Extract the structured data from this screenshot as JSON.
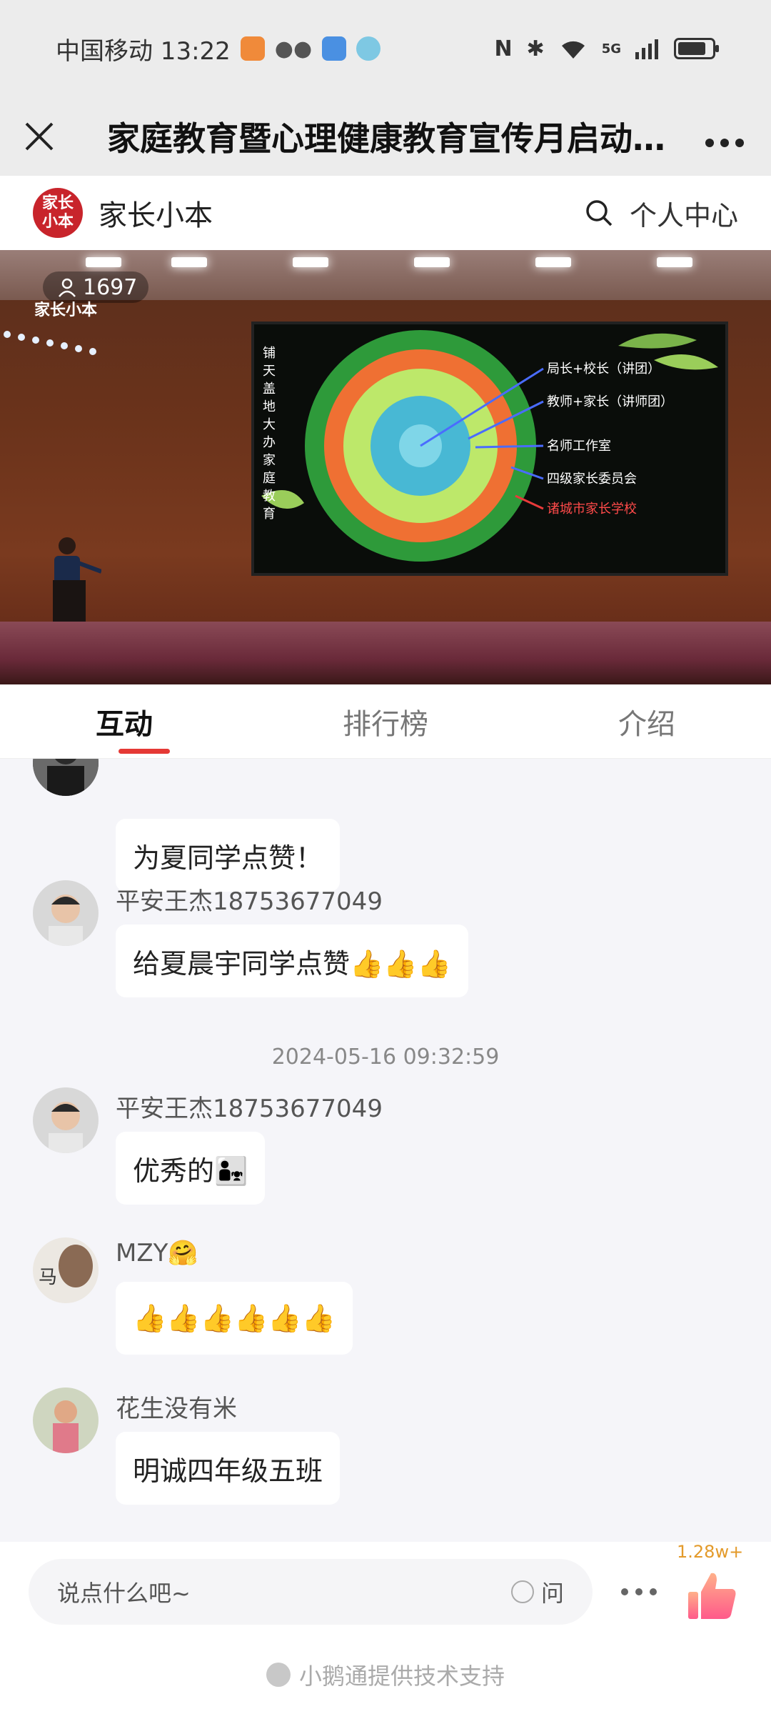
{
  "status_bar": {
    "carrier_time": "中国移动 13:22",
    "network": "5G"
  },
  "title_bar": {
    "title": "家庭教育暨心理健康教育宣传月启动…"
  },
  "brand": {
    "logo_text": "家长小本",
    "name": "家长小本",
    "user_center": "个人中心"
  },
  "video": {
    "viewer_count": "1697",
    "watermark": "家长小本",
    "screen_left_text": "铺天盖地大办家庭教育",
    "screen_labels": [
      "局长+校长（讲团）",
      "教师+家长（讲师团）",
      "名师工作室",
      "四级家长委员会",
      "诸城市家长学校"
    ]
  },
  "tabs": [
    {
      "label": "互动",
      "active": true
    },
    {
      "label": "排行榜",
      "active": false
    },
    {
      "label": "介绍",
      "active": false
    }
  ],
  "chat": {
    "messages": [
      {
        "user": "",
        "text": "为夏同学点赞！"
      },
      {
        "user": "平安王杰18753677049",
        "text": "给夏晨宇同学点赞👍👍👍"
      },
      {
        "user": "平安王杰18753677049",
        "text": "优秀的👨‍👧"
      },
      {
        "user": "MZY🤗",
        "text": "👍👍👍👍👍👍"
      },
      {
        "user": "花生没有米",
        "text": "明诚四年级五班"
      }
    ],
    "timestamp": "2024-05-16 09:32:59",
    "avatar_label_mzy": "马"
  },
  "input": {
    "placeholder": "说点什么吧~",
    "ask_label": "问",
    "like_count": "1.28w+"
  },
  "footer": {
    "text": "小鹅通提供技术支持"
  }
}
